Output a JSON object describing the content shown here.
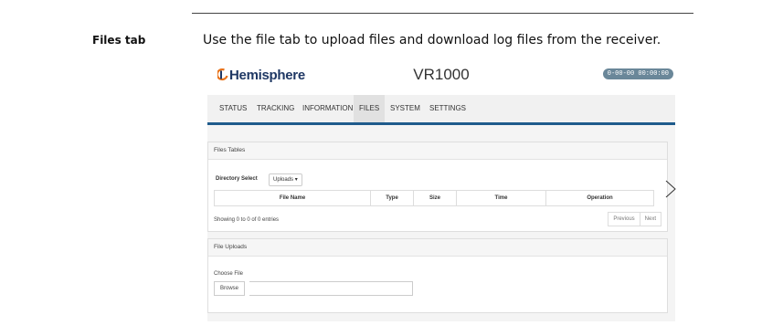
{
  "doc": {
    "side_heading": "Files tab",
    "intro": "Use the file tab to upload files and download log files from the receiver."
  },
  "ui": {
    "brand": "Hemisphere",
    "product": "VR1000",
    "clock": "0-00-00 00:00:00",
    "nav": [
      "STATUS",
      "TRACKING",
      "INFORMATION",
      "FILES",
      "SYSTEM",
      "SETTINGS"
    ],
    "active_tab": "FILES",
    "files_tables": {
      "title": "Files Tables",
      "directory_label": "Directory Select",
      "directory_value": "Uploads",
      "columns": [
        "File Name",
        "Type",
        "Size",
        "Time",
        "Operation"
      ],
      "entries": "Showing 0 to 0 of 0 entries",
      "previous": "Previous",
      "next": "Next"
    },
    "file_uploads": {
      "title": "File Uploads",
      "choose_label": "Choose File",
      "browse": "Browse",
      "file_value": ""
    }
  },
  "colors": {
    "brand_blue": "#1f3864",
    "logo_orange": "#e8731c",
    "nav_underline": "#1f5b8c",
    "clock_bg": "#6a8799"
  },
  "icons": {
    "carousel_next": "chevron-right-icon",
    "dropdown": "caret-down-icon"
  }
}
